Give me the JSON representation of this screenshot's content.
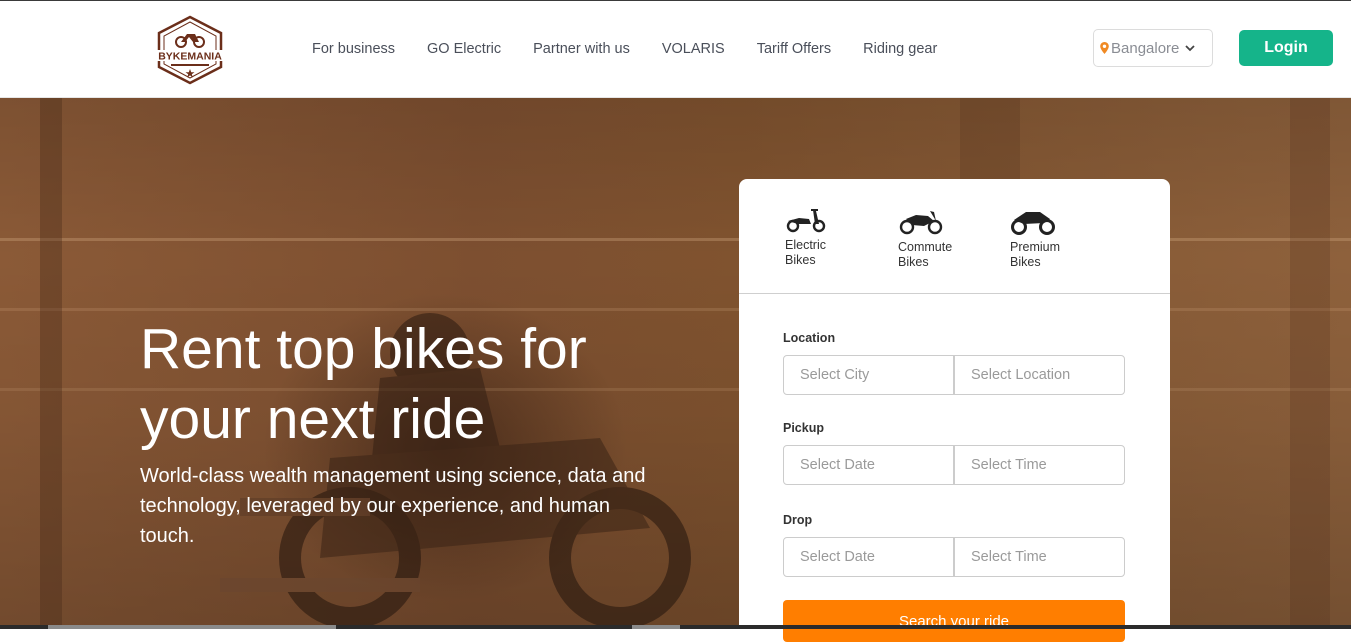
{
  "brand": {
    "name": "BYKEMANIA",
    "logo_icon": "motorcycle-badge-icon"
  },
  "nav": [
    "For business",
    "GO Electric",
    "Partner with us",
    "VOLARIS",
    "Tariff Offers",
    "Riding gear"
  ],
  "header": {
    "city": "Bangalore",
    "login_label": "Login"
  },
  "hero": {
    "title": "Rent top bikes for your next ride",
    "subtitle": "World-class wealth management using science, data and technology, leveraged by our experience, and human touch."
  },
  "booking": {
    "bike_types": [
      {
        "label": "Electric Bikes",
        "icon": "scooter-icon"
      },
      {
        "label": "Commute Bikes",
        "icon": "commute-bike-icon"
      },
      {
        "label": "Premium Bikes",
        "icon": "sport-bike-icon"
      }
    ],
    "location": {
      "label": "Location",
      "city_placeholder": "Select City",
      "location_placeholder": "Select Location"
    },
    "pickup": {
      "label": "Pickup",
      "date_placeholder": "Select Date",
      "time_placeholder": "Select Time"
    },
    "drop": {
      "label": "Drop",
      "date_placeholder": "Select Date",
      "time_placeholder": "Select Time"
    },
    "search_label": "Search your ride"
  },
  "colors": {
    "accent_green": "#15b48a",
    "accent_orange": "#ff7e00",
    "hero_tint": "#8b5a37",
    "logo_brown": "#6b2e1a"
  }
}
